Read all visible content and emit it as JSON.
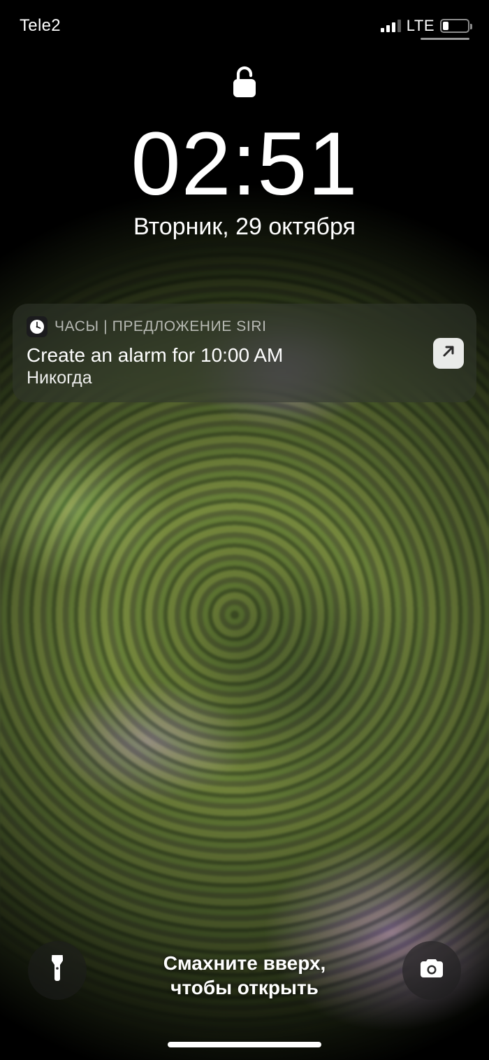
{
  "status": {
    "carrier": "Tele2",
    "network": "LTE"
  },
  "lock": {
    "time": "02:51",
    "date": "Вторник, 29 октября"
  },
  "notification": {
    "header": "ЧАСЫ | ПРЕДЛОЖЕНИЕ SIRI",
    "title": "Create an alarm for 10:00 AM",
    "subtitle": "Никогда"
  },
  "swipe": {
    "line1": "Смахните вверх,",
    "line2": "чтобы открыть"
  }
}
